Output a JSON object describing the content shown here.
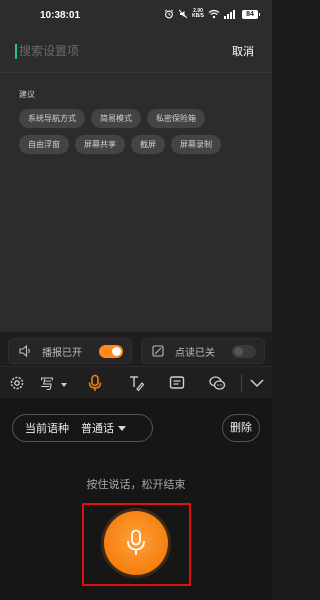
{
  "status_bar": {
    "time": "10:38:01",
    "net_speed_value": "2.00",
    "net_speed_unit": "KB/S",
    "battery": "84",
    "icons": [
      "alarm-icon",
      "mute-icon",
      "network-speed",
      "wifi-icon",
      "signal-icon",
      "battery-icon"
    ]
  },
  "search": {
    "placeholder": "搜索设置项",
    "value": "",
    "cancel_label": "取消"
  },
  "suggestions": {
    "title": "建议",
    "items": [
      "系统导航方式",
      "简易模式",
      "私密保险箱",
      "自由浮窗",
      "屏幕共享",
      "截屏",
      "屏幕录制"
    ]
  },
  "accessibility": {
    "broadcast_label": "播报已开",
    "broadcast_on": true,
    "read_label": "点读已关",
    "read_on": false
  },
  "keyboard_toolbar": {
    "icons": [
      "settings-icon",
      "handwrite-icon",
      "voice-icon",
      "text-edit-icon",
      "clipboard-icon",
      "chat-icon",
      "collapse-icon"
    ],
    "handwrite_label": "写",
    "active": "voice-icon"
  },
  "voice_panel": {
    "language_label": "当前语种",
    "language_value": "普通话",
    "delete_label": "删除",
    "hint": "按住说话，松开结束"
  },
  "colors": {
    "accent_orange": "#f57f10",
    "cursor_green": "#22c39a",
    "highlight_red": "#e01010"
  }
}
